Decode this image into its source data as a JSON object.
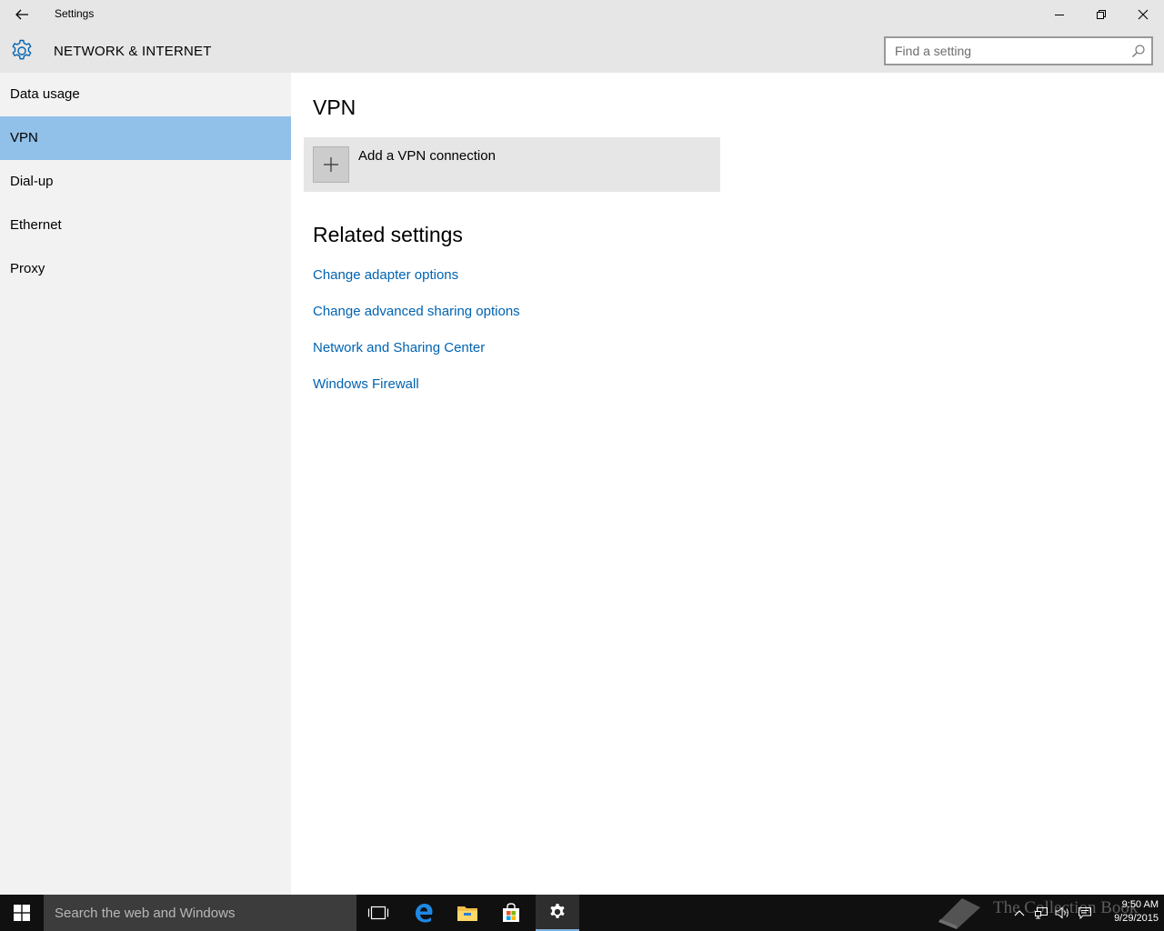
{
  "window": {
    "title": "Settings",
    "controls": {
      "minimize": "minimize-icon",
      "restore": "restore-icon",
      "close": "close-icon"
    }
  },
  "header": {
    "icon": "gear-icon",
    "title": "NETWORK & INTERNET",
    "search_placeholder": "Find a setting"
  },
  "sidebar": {
    "items": [
      {
        "label": "Data usage",
        "active": false
      },
      {
        "label": "VPN",
        "active": true
      },
      {
        "label": "Dial-up",
        "active": false
      },
      {
        "label": "Ethernet",
        "active": false
      },
      {
        "label": "Proxy",
        "active": false
      }
    ]
  },
  "main": {
    "title": "VPN",
    "add_vpn_label": "Add a VPN connection",
    "related_title": "Related settings",
    "related_links": [
      "Change adapter options",
      "Change advanced sharing options",
      "Network and Sharing Center",
      "Windows Firewall"
    ]
  },
  "taskbar": {
    "search_placeholder": "Search the web and Windows",
    "apps": [
      "task-view-icon",
      "edge-icon",
      "file-explorer-icon",
      "store-icon",
      "settings-icon"
    ],
    "active_app": "settings-icon",
    "clock_time": "9:50 AM",
    "clock_date": "9/29/2015",
    "watermark": "The Collection Book"
  },
  "colors": {
    "accent_selected": "#91c0e8",
    "link": "#0063b1",
    "sidebar_bg": "#f2f2f2",
    "header_bg": "#e6e6e6",
    "taskbar_bg": "#101010"
  }
}
